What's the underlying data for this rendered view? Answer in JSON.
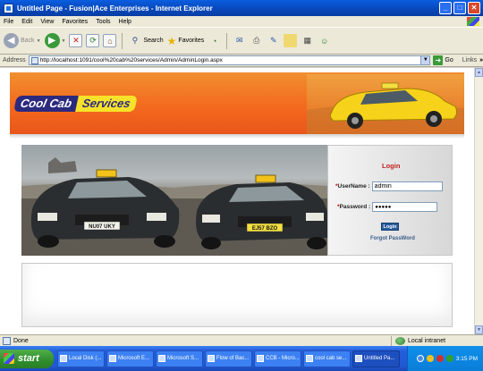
{
  "window": {
    "title": "Untitled Page - Fusion|Ace Enterprises - Internet Explorer",
    "minimize": "_",
    "maximize": "□",
    "close": "✕"
  },
  "menu": [
    "File",
    "Edit",
    "View",
    "Favorites",
    "Tools",
    "Help"
  ],
  "toolbar": {
    "back_label": "Back",
    "search_label": "Search",
    "favorites_label": "Favorites"
  },
  "address": {
    "label": "Address",
    "url": "http://localhost:1091/cool%20cab%20services/Admin/AdminLogin.aspx",
    "go_label": "Go",
    "links_label": "Links"
  },
  "banner": {
    "logo_part1": "Cool Cab",
    "logo_part2": "Services"
  },
  "login": {
    "title": "Login",
    "username_label": "UserName :",
    "username_value": "admin",
    "password_label": "Password :",
    "password_value": "●●●●●",
    "button_label": "Login",
    "forgot_label": "Forgot PassWord",
    "required_mark": "*"
  },
  "photo": {
    "plate_left": "NU07 UKY",
    "plate_right": "EJ57 BZO"
  },
  "status": {
    "text": "Done",
    "zone": "Local intranet"
  },
  "taskbar": {
    "start_label": "start",
    "buttons": [
      {
        "label": "Local Disk (..."
      },
      {
        "label": "Microsoft E..."
      },
      {
        "label": "Microsoft S..."
      },
      {
        "label": "Flow of Bac..."
      },
      {
        "label": "CCB - Micro..."
      },
      {
        "label": "cool cab se..."
      },
      {
        "label": "Untitled Pa..."
      }
    ],
    "clock": "3:15 PM"
  }
}
